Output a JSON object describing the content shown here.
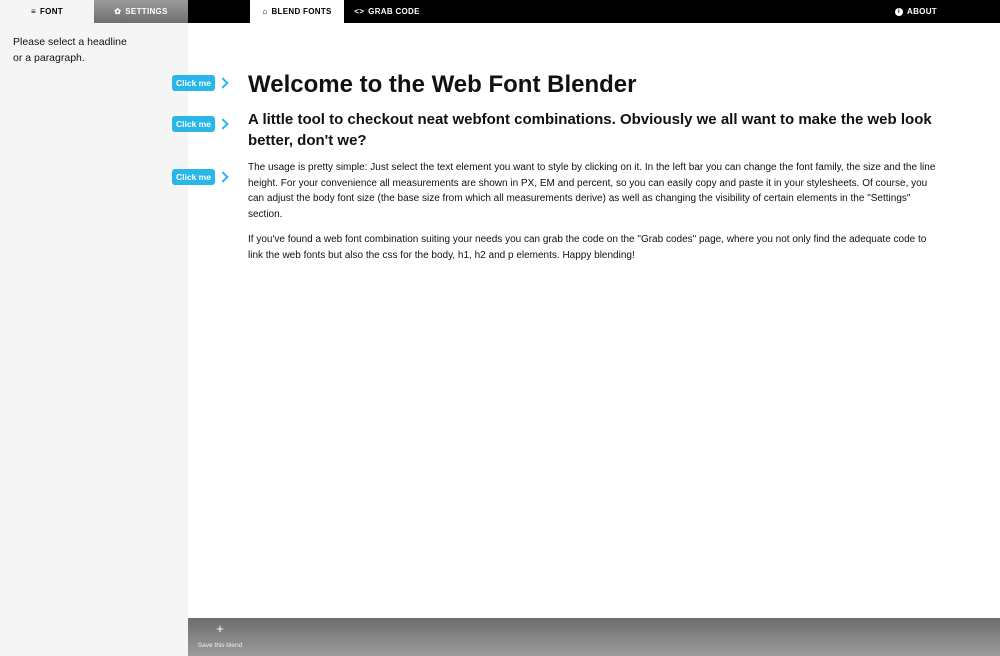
{
  "sidebar": {
    "tabs": [
      {
        "label": "FONT",
        "icon": "menu-icon"
      },
      {
        "label": "SETTINGS",
        "icon": "gear-icon"
      }
    ],
    "message": "Please select a headline or a paragraph."
  },
  "topnav": {
    "blend_fonts": "BLEND FONTS",
    "grab_code": "GRAB CODE",
    "about": "ABOUT"
  },
  "click_me_label": "Click me",
  "content": {
    "title": "Welcome to the Web Font Blender",
    "subtitle": "A little tool to checkout neat webfont combinations. Obviously we all want to make the web look better, don't we?",
    "paragraph1": "The usage is pretty simple: Just select the text element you want to style by clicking on it. In the left bar you can change the font family, the size and the line height. For your convenience all measurements are shown in PX, EM and percent, so you can easily copy and paste it in your stylesheets. Of course, you can adjust the body font size (the base size from which all measurements derive) as well as changing the visibility of certain elements in the \"Settings\" section.",
    "paragraph2": "If you've found a web font combination suiting your needs you can grab the code on the \"Grab codes\" page, where you not only find the adequate code to link the web fonts but also the css for the body, h1, h2 and p elements. Happy blending!"
  },
  "bottombar": {
    "save_label": "Save this blend"
  },
  "colors": {
    "accent": "#29b6e8",
    "nav_bg": "#000000",
    "sidebar_bg": "#f5f5f5"
  }
}
